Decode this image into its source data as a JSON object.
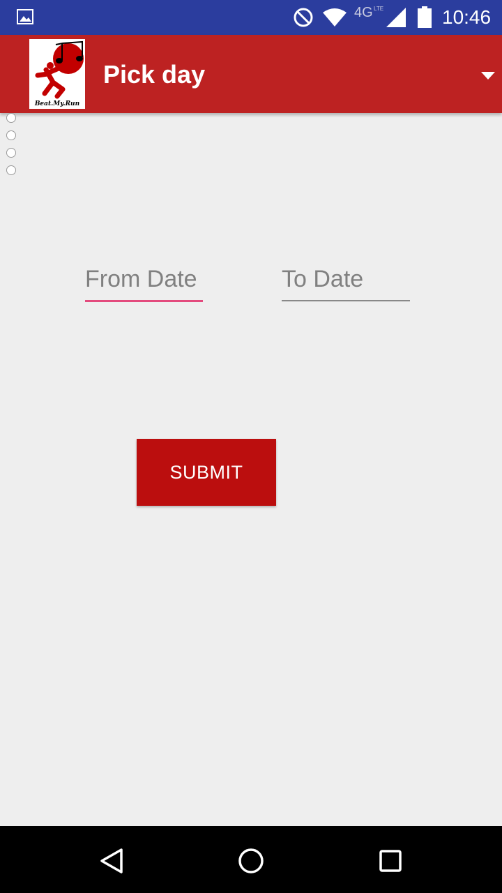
{
  "status_bar": {
    "time": "10:46",
    "network": "4G",
    "network_sub": "LTE",
    "icons": [
      "gallery-icon",
      "do-not-disturb-icon",
      "wifi-icon",
      "signal-icon",
      "battery-icon"
    ]
  },
  "app_bar": {
    "title": "Pick day",
    "logo_caption": "Beat.My.Run",
    "logo_icon": "runner-music-logo",
    "menu_icon": "dropdown-arrow-icon",
    "color": "#bd2222"
  },
  "form": {
    "from_date_placeholder": "From Date",
    "to_date_placeholder": "To Date",
    "submit_label": "SUBMIT",
    "accent_color": "#e34a7d",
    "button_color": "#bb0e0e"
  },
  "nav_bar": {
    "icons": [
      "back-icon",
      "home-icon",
      "recents-icon"
    ]
  }
}
